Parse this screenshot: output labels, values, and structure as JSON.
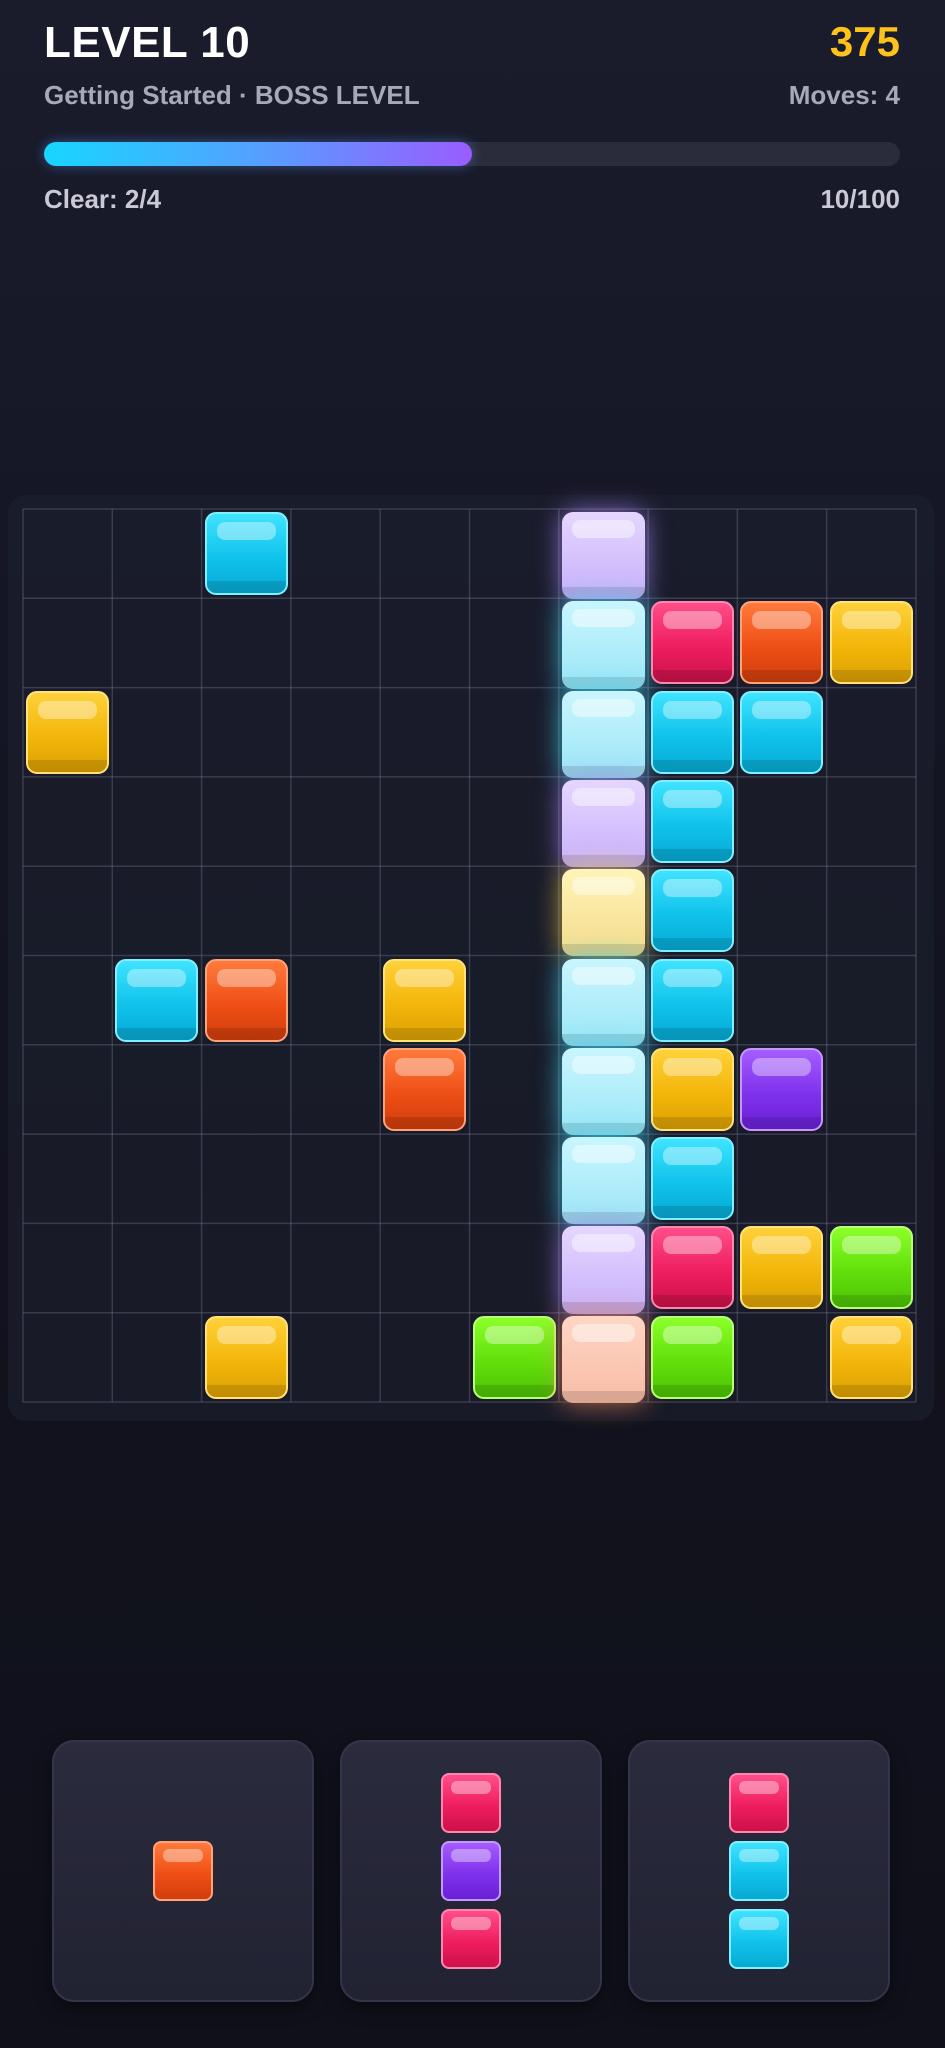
{
  "header": {
    "level_title": "LEVEL 10",
    "score": "375",
    "subtitle": "Getting Started · BOSS LEVEL",
    "moves": "Moves: 4",
    "progress_fraction": 0.5,
    "clear": "Clear: 2/4",
    "count": "10/100"
  },
  "colors": {
    "cyan": "#10c3eb",
    "red": "#ef1e5f",
    "orange": "#ef4f16",
    "yellow": "#f3b60a",
    "purple": "#7f32ec",
    "green": "#62e00b",
    "score": "#ffc21a",
    "progress_start": "#17d6ff",
    "progress_end": "#9a5cff"
  },
  "board": {
    "rows": 10,
    "cols": 10,
    "blocks": [
      {
        "row": 0,
        "col": 2,
        "color": "cyan"
      },
      {
        "row": 0,
        "col": 6,
        "color": "lavender",
        "highlight": true
      },
      {
        "row": 1,
        "col": 6,
        "color": "aqua",
        "highlight": true
      },
      {
        "row": 1,
        "col": 7,
        "color": "red"
      },
      {
        "row": 1,
        "col": 8,
        "color": "orange"
      },
      {
        "row": 1,
        "col": 9,
        "color": "yellow"
      },
      {
        "row": 2,
        "col": 0,
        "color": "yellow"
      },
      {
        "row": 2,
        "col": 6,
        "color": "aqua",
        "highlight": true
      },
      {
        "row": 2,
        "col": 7,
        "color": "cyan"
      },
      {
        "row": 2,
        "col": 8,
        "color": "cyan"
      },
      {
        "row": 3,
        "col": 6,
        "color": "lavender",
        "highlight": true
      },
      {
        "row": 3,
        "col": 7,
        "color": "cyan"
      },
      {
        "row": 4,
        "col": 6,
        "color": "cream",
        "highlight": true
      },
      {
        "row": 4,
        "col": 7,
        "color": "cyan"
      },
      {
        "row": 5,
        "col": 1,
        "color": "cyan"
      },
      {
        "row": 5,
        "col": 2,
        "color": "orange"
      },
      {
        "row": 5,
        "col": 4,
        "color": "yellow"
      },
      {
        "row": 5,
        "col": 6,
        "color": "aqua",
        "highlight": true
      },
      {
        "row": 5,
        "col": 7,
        "color": "cyan"
      },
      {
        "row": 6,
        "col": 4,
        "color": "orange"
      },
      {
        "row": 6,
        "col": 6,
        "color": "aqua",
        "highlight": true
      },
      {
        "row": 6,
        "col": 7,
        "color": "yellow"
      },
      {
        "row": 6,
        "col": 8,
        "color": "purple"
      },
      {
        "row": 7,
        "col": 6,
        "color": "aqua",
        "highlight": true
      },
      {
        "row": 7,
        "col": 7,
        "color": "cyan"
      },
      {
        "row": 8,
        "col": 6,
        "color": "lavender",
        "highlight": true
      },
      {
        "row": 8,
        "col": 7,
        "color": "red"
      },
      {
        "row": 8,
        "col": 8,
        "color": "yellow"
      },
      {
        "row": 8,
        "col": 9,
        "color": "green"
      },
      {
        "row": 9,
        "col": 2,
        "color": "yellow"
      },
      {
        "row": 9,
        "col": 5,
        "color": "green"
      },
      {
        "row": 9,
        "col": 6,
        "color": "peach",
        "highlight": true
      },
      {
        "row": 9,
        "col": 7,
        "color": "green"
      },
      {
        "row": 9,
        "col": 9,
        "color": "yellow"
      }
    ]
  },
  "tray": [
    {
      "name": "piece-single-orange",
      "cells": [
        "orange"
      ]
    },
    {
      "name": "piece-vertical-red-purple-red",
      "cells": [
        "red",
        "purple",
        "red"
      ]
    },
    {
      "name": "piece-vertical-red-cyan-cyan",
      "cells": [
        "red",
        "cyan",
        "cyan"
      ]
    }
  ]
}
